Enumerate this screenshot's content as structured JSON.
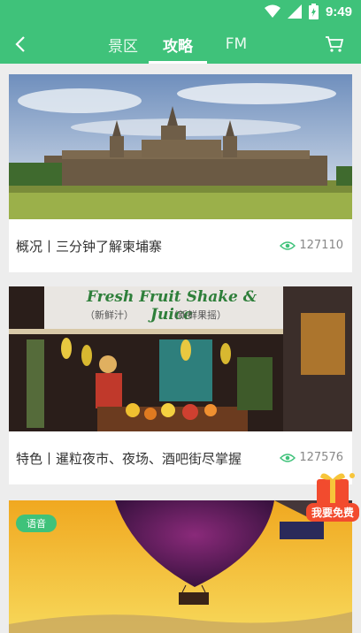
{
  "status": {
    "time": "9:49",
    "icons": [
      "wifi-icon",
      "signal-icon",
      "battery-icon"
    ]
  },
  "nav": {
    "tabs": [
      {
        "label": "景区",
        "active": false
      },
      {
        "label": "攻略",
        "active": true
      },
      {
        "label": "FM",
        "active": false
      }
    ],
    "back_icon": "back-arrow-icon",
    "cart_icon": "cart-icon"
  },
  "cards": [
    {
      "title": "概况丨三分钟了解柬埔寨",
      "views": "127110",
      "image": "angkor-wat-photo"
    },
    {
      "title": "特色丨暹粒夜市、夜场、酒吧街尽掌握",
      "views": "127576",
      "image": "fruit-stall-photo",
      "sign_text": "Fresh Fruit Shake & Juice",
      "sign_sub": [
        "（新鲜汁）",
        "（新鲜果摇）"
      ]
    },
    {
      "badge": "语音",
      "image": "balloon-photo"
    }
  ],
  "gift": {
    "label": "我要免费"
  },
  "colors": {
    "brand": "#3fc27a",
    "bg": "#ededed"
  }
}
